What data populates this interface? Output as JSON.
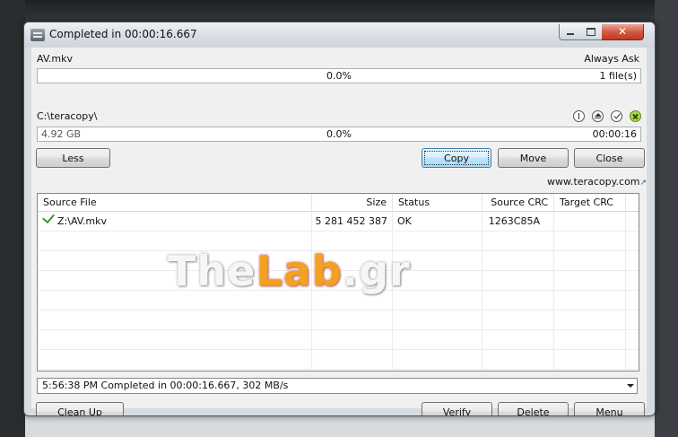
{
  "window": {
    "title": "Completed in 00:00:16.667",
    "close_glyph": "✕"
  },
  "source": {
    "file_name": "AV.mkv",
    "mode": "Always Ask",
    "progress": "0.0%",
    "file_count": "1 file(s)"
  },
  "target": {
    "path": "C:\\teracopy\\",
    "size": "4.92 GB",
    "progress": "0.0%",
    "elapsed": "00:00:16"
  },
  "icons": [
    "info-icon",
    "eject-icon",
    "check-icon",
    "cancel-icon"
  ],
  "buttons": {
    "less": "Less",
    "copy": "Copy",
    "move": "Move",
    "close": "Close",
    "clean_up": "Clean Up",
    "verify": "Verify",
    "delete": "Delete",
    "menu": "Menu"
  },
  "link": {
    "text": "www.teracopy.com",
    "arrow": "↗"
  },
  "table": {
    "columns": [
      "Source File",
      "Size",
      "Status",
      "Source CRC",
      "Target CRC"
    ],
    "rows": [
      {
        "file": "Z:\\AV.mkv",
        "size": "5 281 452 387",
        "status": "OK",
        "source_crc": "1263C85A",
        "target_crc": ""
      }
    ]
  },
  "status_bar": {
    "text": "5:56:38 PM Completed in 00:00:16.667, 302 MB/s"
  },
  "watermark": {
    "part1": "The",
    "part2": "Lab",
    "part3": ".gr"
  },
  "colors": {
    "accent_check": "#2e9b2a",
    "close_button": "#c2391f",
    "watermark_lab": "#f4a020"
  }
}
